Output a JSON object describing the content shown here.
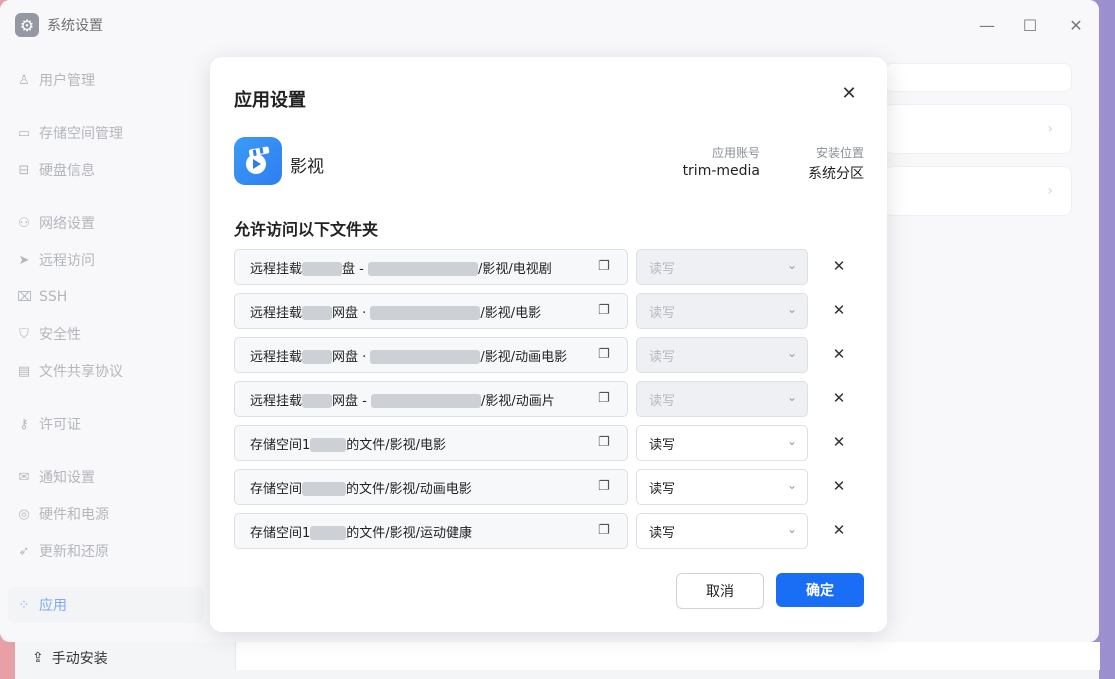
{
  "window": {
    "title": "系统设置"
  },
  "sidebar": {
    "items": [
      {
        "label": "用户管理",
        "icon": "user-icon"
      },
      {
        "label": "存储空间管理",
        "icon": "storage-icon"
      },
      {
        "label": "硬盘信息",
        "icon": "disk-icon"
      },
      {
        "label": "网络设置",
        "icon": "network-icon"
      },
      {
        "label": "远程访问",
        "icon": "send-icon"
      },
      {
        "label": "SSH",
        "icon": "ssh-icon"
      },
      {
        "label": "安全性",
        "icon": "shield-icon"
      },
      {
        "label": "文件共享协议",
        "icon": "file-icon"
      },
      {
        "label": "许可证",
        "icon": "key-icon"
      },
      {
        "label": "通知设置",
        "icon": "mail-icon"
      },
      {
        "label": "硬件和电源",
        "icon": "hardware-icon"
      },
      {
        "label": "更新和还原",
        "icon": "rocket-icon"
      },
      {
        "label": "应用",
        "icon": "apps-icon"
      }
    ],
    "manual_install": "手动安装"
  },
  "modal": {
    "title": "应用设置",
    "app_name": "影视",
    "account_label": "应用账号",
    "account_value": "trim-media",
    "location_label": "安装位置",
    "location_value": "系统分区",
    "section_title": "允许访问以下文件夹",
    "rows": [
      {
        "prefix": "远程挂载",
        "mid": "盘 - ",
        "suffix": "/影视/电视剧",
        "perm": "读写",
        "disabled": true
      },
      {
        "prefix": "远程挂载",
        "mid": "网盘 · ",
        "suffix": "/影视/电影",
        "perm": "读写",
        "disabled": true
      },
      {
        "prefix": "远程挂载",
        "mid": "网盘 · ",
        "suffix": "/影视/动画电影",
        "perm": "读写",
        "disabled": true
      },
      {
        "prefix": "远程挂载",
        "mid": "网盘 - ",
        "suffix": "/影视/动画片",
        "perm": "读写",
        "disabled": true
      },
      {
        "prefix": "存储空间1",
        "mid": "",
        "suffix": "的文件/影视/电影",
        "perm": "读写",
        "disabled": false
      },
      {
        "prefix": "存储空间",
        "mid": "",
        "suffix": "的文件/影视/动画电影",
        "perm": "读写",
        "disabled": false
      },
      {
        "prefix": "存储空间1",
        "mid": "",
        "suffix": "的文件/影视/运动健康",
        "perm": "读写",
        "disabled": false
      }
    ],
    "cancel": "取消",
    "ok": "确定"
  }
}
